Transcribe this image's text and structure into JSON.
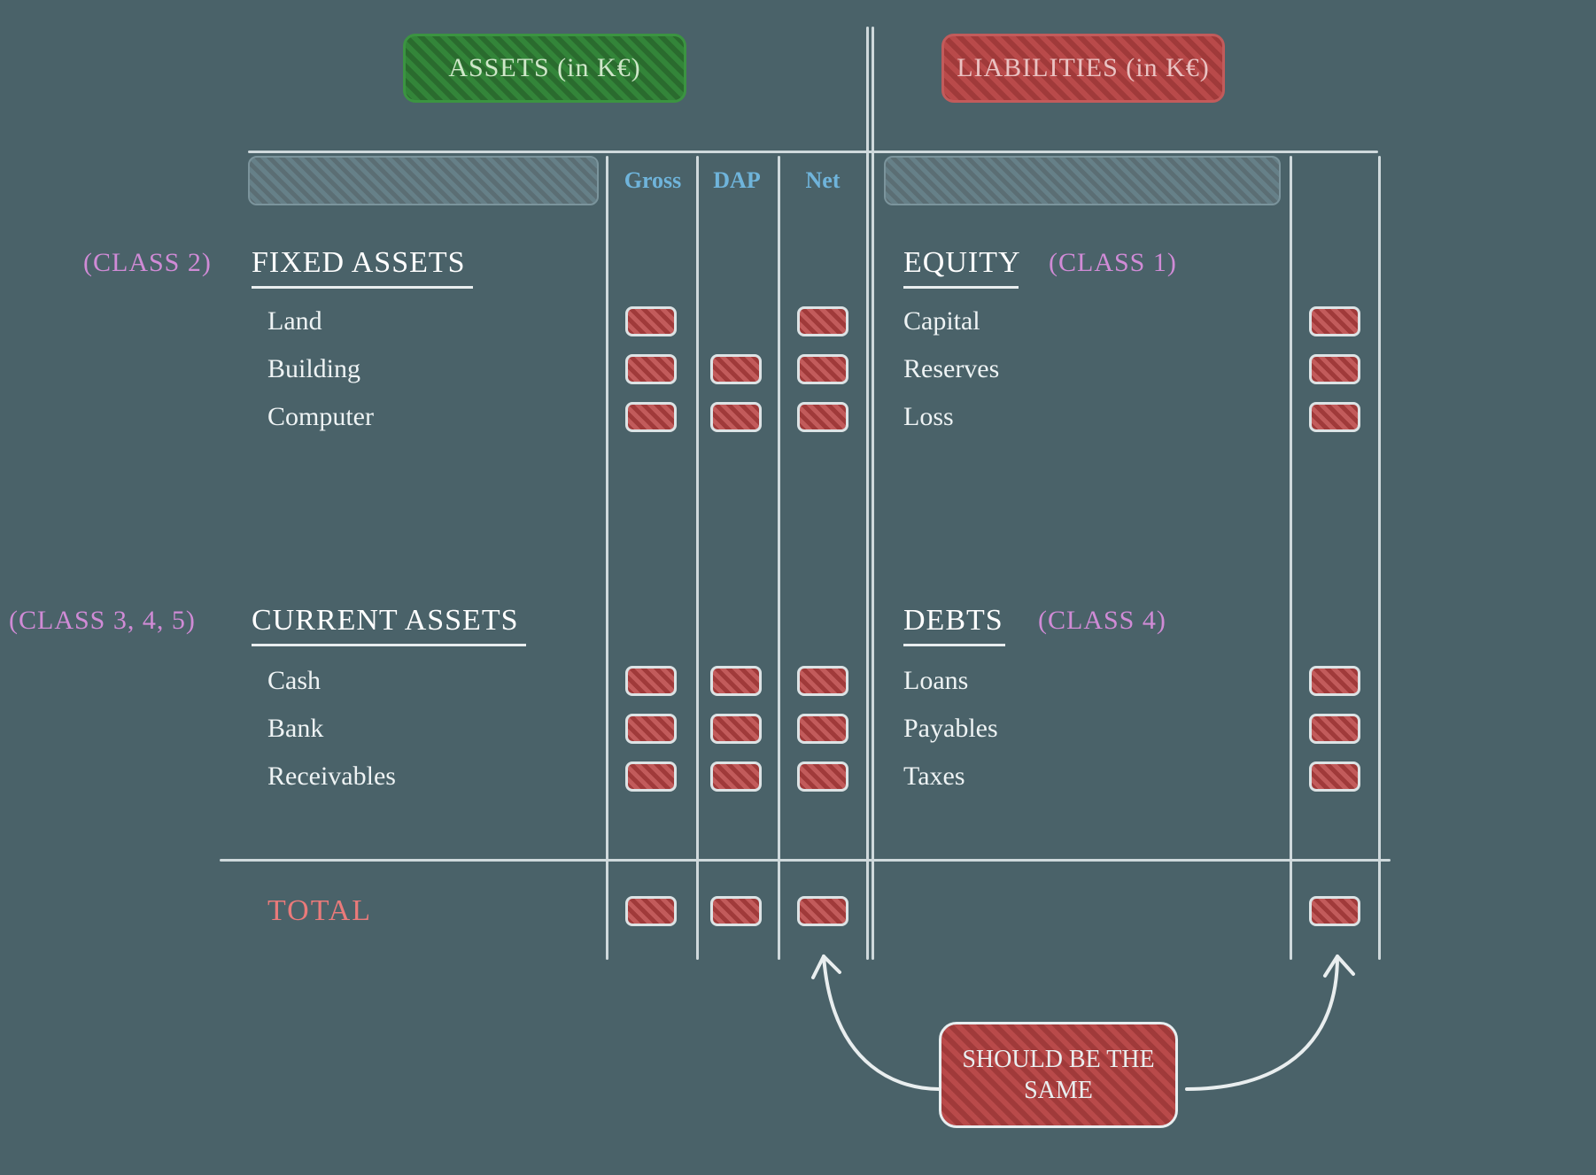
{
  "headers": {
    "assets": "ASSETS (in K€)",
    "liabilities": "LIABILITIES (in K€)"
  },
  "columns": {
    "gross": "Gross",
    "dap": "DAP",
    "net": "Net"
  },
  "assets": {
    "fixed": {
      "class": "(CLASS 2)",
      "title": "FIXED ASSETS",
      "items": {
        "land": "Land",
        "building": "Building",
        "computer": "Computer"
      }
    },
    "current": {
      "class": "(CLASS 3, 4, 5)",
      "title": "CURRENT ASSETS",
      "items": {
        "cash": "Cash",
        "bank": "Bank",
        "receivables": "Receivables"
      }
    }
  },
  "liabilities": {
    "equity": {
      "class": "(CLASS 1)",
      "title": "EQUITY",
      "items": {
        "capital": "Capital",
        "reserves": "Reserves",
        "loss": "Loss"
      }
    },
    "debts": {
      "class": "(CLASS 4)",
      "title": "DEBTS",
      "items": {
        "loans": "Loans",
        "payables": "Payables",
        "taxes": "Taxes"
      }
    }
  },
  "total": "TOTAL",
  "note": "SHOULD BE THE SAME"
}
